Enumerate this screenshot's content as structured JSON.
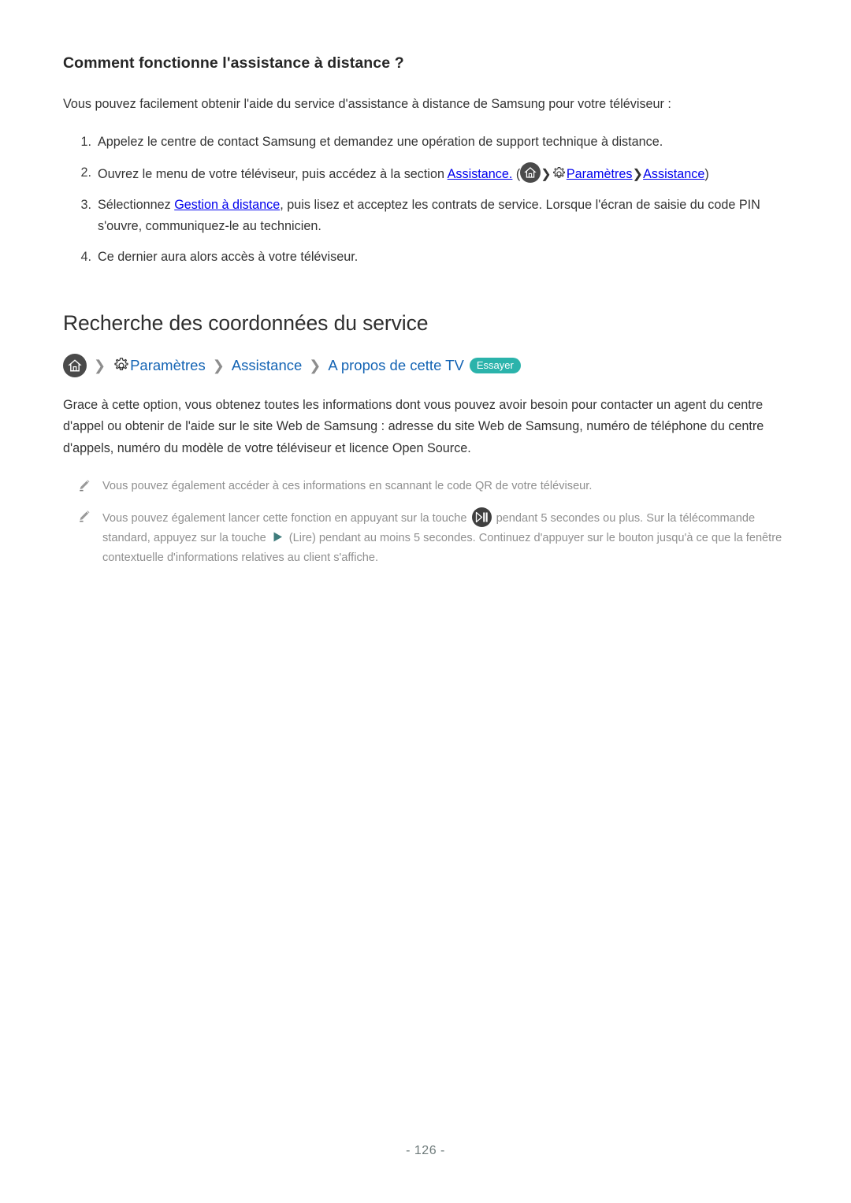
{
  "section": {
    "title": "Comment fonctionne l'assistance à distance ?",
    "lead": "Vous pouvez facilement obtenir l'aide du service d'assistance à distance de Samsung pour votre téléviseur :",
    "steps": [
      {
        "num": "1.",
        "text": "Appelez le centre de contact Samsung et demandez une opération de support technique à distance."
      },
      {
        "num": "2.",
        "pre": "Ouvrez le menu de votre téléviseur, puis accédez à la section ",
        "link1": "Assistance.",
        "paren_open": " (",
        "home_icon": "home-icon",
        "chev1": "❯",
        "gear_icon": "gear-icon",
        "link2": "Paramètres",
        "chev2": "❯",
        "link3": "Assistance",
        "paren_close": ")"
      },
      {
        "num": "3.",
        "pre": "Sélectionnez ",
        "link1": "Gestion à distance",
        "post": ", puis lisez et acceptez les contrats de service. Lorsque l'écran de saisie du code PIN s'ouvre, communiquez-le au technicien."
      },
      {
        "num": "4.",
        "text": "Ce dernier aura alors accès à votre téléviseur."
      }
    ]
  },
  "main": {
    "heading": "Recherche des coordonnées du service",
    "breadcrumb": {
      "home_icon": "home-icon",
      "chevron": "❯",
      "gear_icon": "gear-icon",
      "item1": "Paramètres",
      "item2": "Assistance",
      "item3": "A propos de cette TV",
      "badge": "Essayer"
    },
    "paragraph": "Grace à cette option, vous obtenez toutes les informations dont vous pouvez avoir besoin pour contacter un agent du centre d'appel ou obtenir de l'aide sur le site Web de Samsung : adresse du site Web de Samsung, numéro de téléphone du centre d'appels, numéro du modèle de votre téléviseur et licence Open Source.",
    "notes": [
      {
        "icon": "pencil-icon",
        "text": "Vous pouvez également accéder à ces informations en scannant le code QR de votre téléviseur."
      },
      {
        "icon": "pencil-icon",
        "part1": "Vous pouvez également lancer cette fonction en appuyant sur la touche ",
        "playpause_icon": "play-pause-icon",
        "part2": " pendant 5 secondes ou plus. Sur la télécommande standard, appuyez sur la touche ",
        "play_icon": "play-icon",
        "part3": " (Lire) pendant au moins 5 secondes. Continuez d'appuyer sur le bouton jusqu'à ce que la fenêtre contextuelle d'informations relatives au client s'affiche."
      }
    ]
  },
  "footer": {
    "page_number": "- 126 -"
  },
  "colors": {
    "link_blue": "#1464b4",
    "badge_teal": "#2bb3ab",
    "note_gray": "#8f8f8f",
    "icon_dark": "#4a4a4a"
  }
}
